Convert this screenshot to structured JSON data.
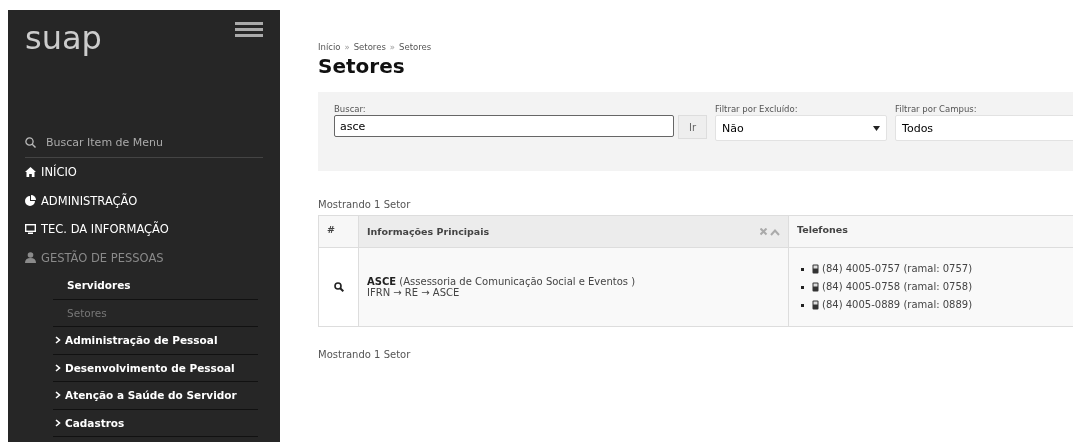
{
  "sidebar": {
    "logo": "suap",
    "search": {
      "placeholder": "Buscar Item de Menu"
    },
    "items": [
      {
        "label": "INÍCIO",
        "expanded": false
      },
      {
        "label": "ADMINISTRAÇÃO",
        "expanded": false
      },
      {
        "label": "TEC. DA INFORMAÇÃO",
        "expanded": false
      },
      {
        "label": "GESTÃO DE PESSOAS",
        "expanded": true,
        "children": [
          {
            "label": "Servidores",
            "kind": "link",
            "selected": false
          },
          {
            "label": "Setores",
            "kind": "link",
            "selected": true
          },
          {
            "label": "Administração de Pessoal",
            "kind": "group",
            "selected": false
          },
          {
            "label": "Desenvolvimento de Pessoal",
            "kind": "group",
            "selected": false
          },
          {
            "label": "Atenção a Saúde do Servidor",
            "kind": "group",
            "selected": false
          },
          {
            "label": "Cadastros",
            "kind": "group",
            "selected": false
          }
        ]
      }
    ]
  },
  "breadcrumb": [
    {
      "label": "Início"
    },
    {
      "separator": "»",
      "label": "Setores"
    },
    {
      "separator": "»",
      "label": "Setores"
    }
  ],
  "title": "Setores",
  "filters": [
    {
      "kind": "search",
      "label": "Buscar:",
      "value": "asce",
      "button": "Ir"
    },
    {
      "kind": "select",
      "label": "Filtrar por Excluído:",
      "value": "Não"
    },
    {
      "kind": "select",
      "label": "Filtrar por Campus:",
      "value": "Todos"
    }
  ],
  "count_top": "Mostrando 1 Setor",
  "table": {
    "columns": [
      {
        "label": "#",
        "sorted": false
      },
      {
        "label": "Informações Principais",
        "sorted": true
      },
      {
        "label": "Telefones",
        "sorted": false
      }
    ],
    "rows": [
      {
        "name": "ASCE",
        "description": "(Assessoria de Comunicação Social e Eventos )",
        "path": "IFRN → RE → ASCE",
        "phones": [
          "(84) 4005-0757 (ramal: 0757)",
          "(84) 4005-0758 (ramal: 0758)",
          "(84) 4005-0889 (ramal: 0889)"
        ]
      }
    ]
  },
  "count_bottom": "Mostrando 1 Setor"
}
